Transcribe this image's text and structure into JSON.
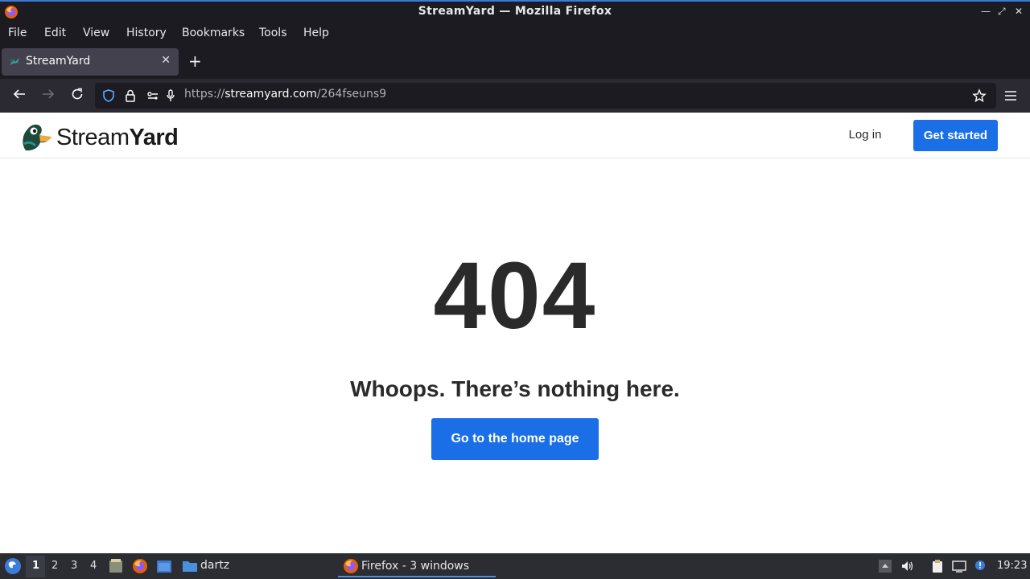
{
  "window": {
    "title": "StreamYard — Mozilla Firefox",
    "controls": [
      "—",
      "⤢",
      "✕"
    ]
  },
  "menu": {
    "file": "File",
    "edit": "Edit",
    "view": "View",
    "history": "History",
    "bookmarks": "Bookmarks",
    "tools": "Tools",
    "help": "Help"
  },
  "tab": {
    "label": "StreamYard",
    "close": "✕",
    "new_tab": "+"
  },
  "url": {
    "prefix": "https://",
    "domain": "streamyard.com",
    "path": "/264fseuns9"
  },
  "site": {
    "logo_regular": "Stream",
    "logo_bold": "Yard",
    "login": "Log in",
    "get_started": "Get started"
  },
  "error": {
    "code": "404",
    "message": "Whoops. There’s nothing here.",
    "home_button": "Go to the home page"
  },
  "taskbar": {
    "workspaces": [
      "1",
      "2",
      "3",
      "4"
    ],
    "active_workspace": "1",
    "folder_label": "dartz",
    "task_label": "Firefox - 3 windows",
    "clock": "19:23"
  },
  "colors": {
    "accent_blue": "#1a6ee6",
    "chrome_dark": "#1c1b22",
    "text_dark": "#2a2a2a"
  }
}
